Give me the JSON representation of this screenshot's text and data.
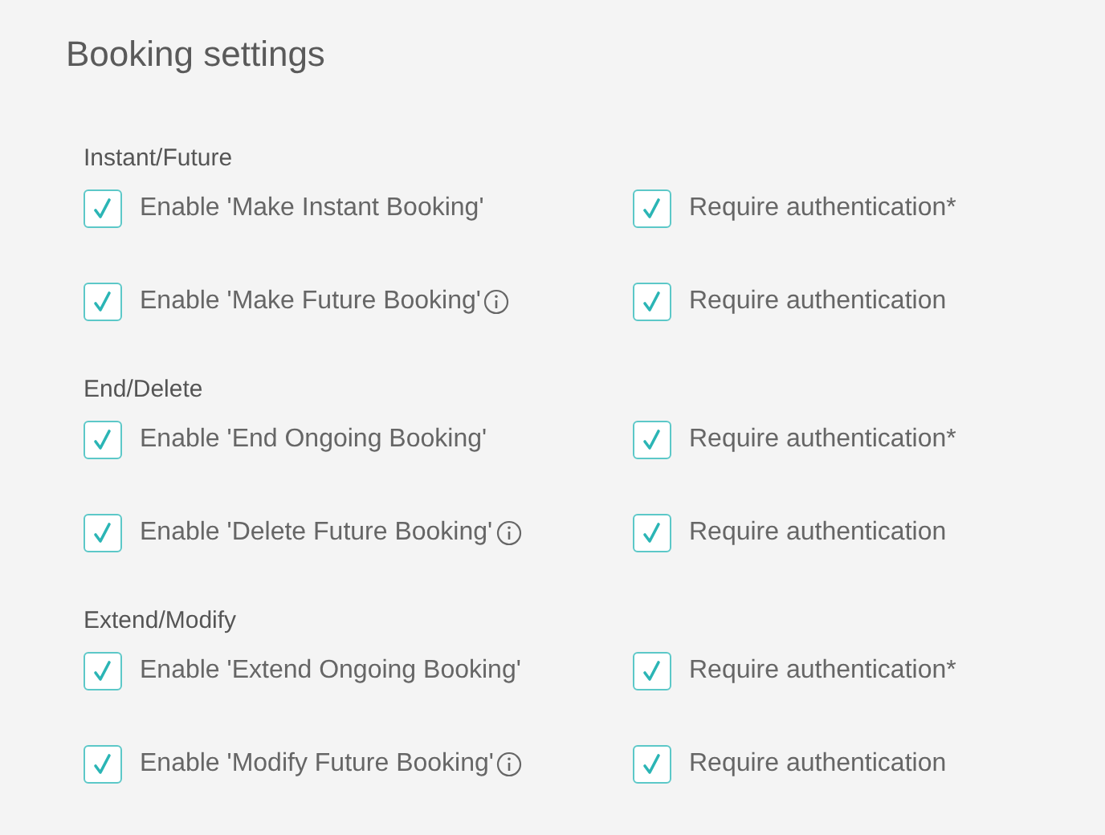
{
  "title": "Booking settings",
  "sections": [
    {
      "title": "Instant/Future",
      "rows": [
        {
          "enable": {
            "label": "Enable 'Make Instant Booking'",
            "checked": true,
            "info": false
          },
          "auth": {
            "label": "Require authentication*",
            "checked": true
          }
        },
        {
          "enable": {
            "label": "Enable 'Make Future Booking'",
            "checked": true,
            "info": true
          },
          "auth": {
            "label": "Require authentication",
            "checked": true
          }
        }
      ]
    },
    {
      "title": "End/Delete",
      "rows": [
        {
          "enable": {
            "label": "Enable 'End Ongoing Booking'",
            "checked": true,
            "info": false
          },
          "auth": {
            "label": "Require authentication*",
            "checked": true
          }
        },
        {
          "enable": {
            "label": "Enable 'Delete Future Booking'",
            "checked": true,
            "info": true
          },
          "auth": {
            "label": "Require authentication",
            "checked": true
          }
        }
      ]
    },
    {
      "title": "Extend/Modify",
      "rows": [
        {
          "enable": {
            "label": "Enable 'Extend Ongoing Booking'",
            "checked": true,
            "info": false
          },
          "auth": {
            "label": "Require authentication*",
            "checked": true
          }
        },
        {
          "enable": {
            "label": "Enable 'Modify Future Booking'",
            "checked": true,
            "info": true
          },
          "auth": {
            "label": "Require authentication",
            "checked": true
          }
        }
      ]
    }
  ]
}
